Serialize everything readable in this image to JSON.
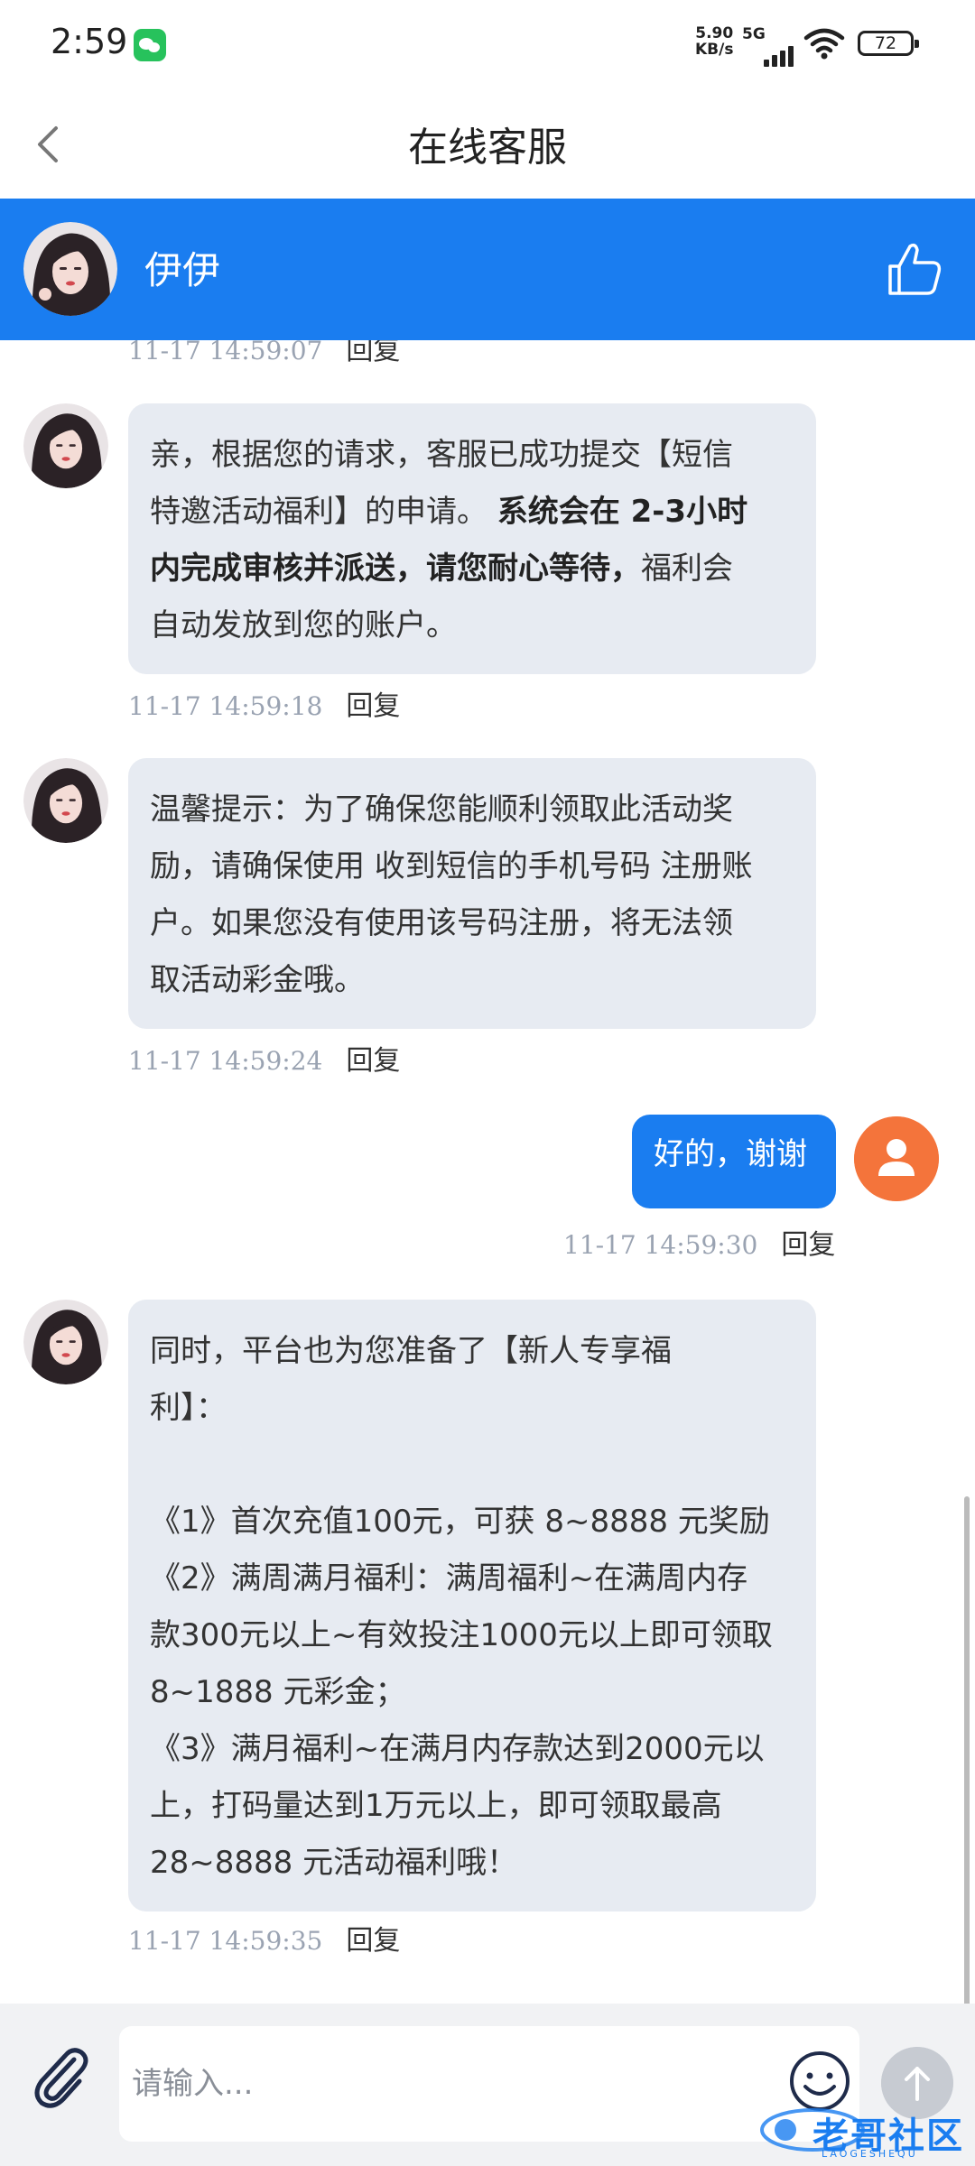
{
  "status_bar": {
    "time": "2:59",
    "net_speed_value": "5.90",
    "net_speed_unit": "KB/s",
    "network": "5G",
    "battery": "72"
  },
  "nav": {
    "title": "在线客服"
  },
  "agent": {
    "name": "伊伊"
  },
  "messages": [
    {
      "sender": "agent",
      "time": "11-17 14:59:07",
      "reply": "回复",
      "partially_visible": true
    },
    {
      "sender": "agent",
      "lines": [
        "亲，根据您的请求，客服已成功提交【短信",
        "特邀活动福利】的申请。 ",
        "内完成审核并派送，请您耐心等待，",
        "自动发放到您的账户。"
      ],
      "bold_1": "系统会在 2-3小时",
      "after_bold": "福利会",
      "time": "11-17 14:59:18",
      "reply": "回复"
    },
    {
      "sender": "agent",
      "lines": [
        "温馨提示：为了确保您能顺利领取此活动奖",
        "励，请确保使用 收到短信的手机号码 注册账",
        "户。如果您没有使用该号码注册，将无法领",
        "取活动彩金哦。"
      ],
      "time": "11-17 14:59:24",
      "reply": "回复"
    },
    {
      "sender": "user",
      "text": "好的，谢谢",
      "time": "11-17 14:59:30",
      "reply": "回复"
    },
    {
      "sender": "agent",
      "lines": [
        "同时，平台也为您准备了【新人专享福",
        "利】：",
        "",
        "《1》首次充值100元，可获 8~8888 元奖励",
        "《2》满周满月福利：满周福利~在满周内存",
        "款300元以上~有效投注1000元以上即可领取",
        "8~1888 元彩金；",
        "《3》满月福利~在满月内存款达到2000元以",
        "上，打码量达到1万元以上，即可领取最高",
        "28~8888 元活动福利哦！"
      ],
      "time": "11-17 14:59:35",
      "reply": "回复"
    }
  ],
  "input": {
    "placeholder": "请输入..."
  },
  "watermark": {
    "text": "老哥社区",
    "subtext": "LAOGESHEQU"
  },
  "colors": {
    "brand_blue": "#1a7df0",
    "bubble_gray": "#e7ebf2",
    "user_avatar": "#f4743b"
  }
}
